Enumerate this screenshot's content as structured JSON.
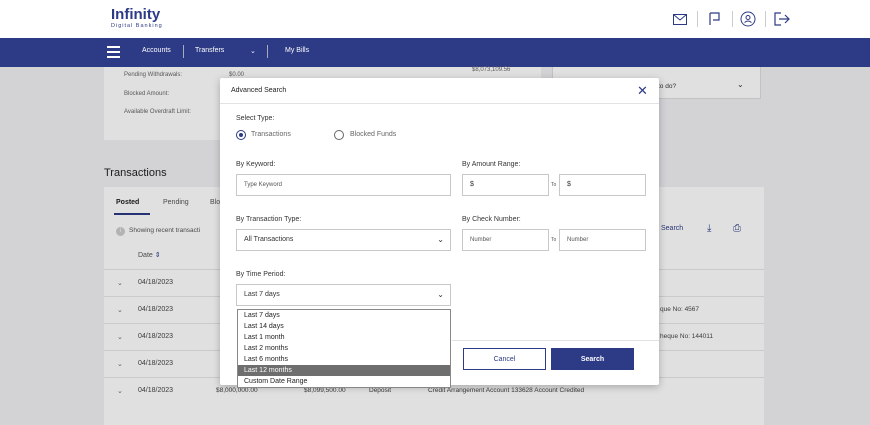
{
  "header": {
    "logo_main": "Infinity",
    "logo_sub": "Digital Banking",
    "icons": [
      "mail-icon",
      "flag-icon",
      "user-icon",
      "logout-icon"
    ]
  },
  "nav": {
    "items": [
      "Accounts",
      "Transfers",
      "My Bills"
    ]
  },
  "background": {
    "kv_labels": [
      "Pending Withdrawals:",
      "Blocked Amount:",
      "Available Overdraft Limit:"
    ],
    "kv_values": [
      "$0.00",
      "$8,073,109.56"
    ],
    "what_to_do": "to do?",
    "transactions_title": "Transactions",
    "tabs": [
      "Posted",
      "Pending",
      "Blo"
    ],
    "info_text": "Showing recent transacti",
    "date_header": "Date",
    "search_label": "Search",
    "rows": [
      {
        "date": "04/18/2023",
        "extra": ""
      },
      {
        "date": "04/18/2023",
        "extra": "que No: 4567"
      },
      {
        "date": "04/18/2023",
        "extra": "heque No: 144011"
      },
      {
        "date": "04/18/2023",
        "extra": ""
      }
    ],
    "last_row": {
      "date": "04/18/2023",
      "amount": "$8,000,000.00",
      "balance": "$8,099,500.00",
      "type": "Deposit",
      "description": "Credit Arrangement Account 133628 Account Credited"
    }
  },
  "modal": {
    "title": "Advanced Search",
    "select_type_label": "Select Type:",
    "radio_transactions": "Transactions",
    "radio_blocked": "Blocked Funds",
    "keyword_label": "By Keyword:",
    "keyword_placeholder": "Type Keyword",
    "amount_label": "By Amount Range:",
    "amount_from_prefix": "$",
    "amount_to_prefix": "$",
    "to_text": "To",
    "txn_type_label": "By Transaction Type:",
    "txn_type_value": "All Transactions",
    "check_label": "By Check Number:",
    "check_from_placeholder": "Number",
    "check_to_placeholder": "Number",
    "time_label": "By Time Period:",
    "time_value": "Last 7 days",
    "cancel": "Cancel",
    "search": "Search"
  },
  "dropdown": {
    "options": [
      "Last 7 days",
      "Last 14 days",
      "Last 1 month",
      "Last 2 months",
      "Last 6 months",
      "Last 12 months",
      "Custom Date Range"
    ],
    "highlighted_index": 5
  }
}
